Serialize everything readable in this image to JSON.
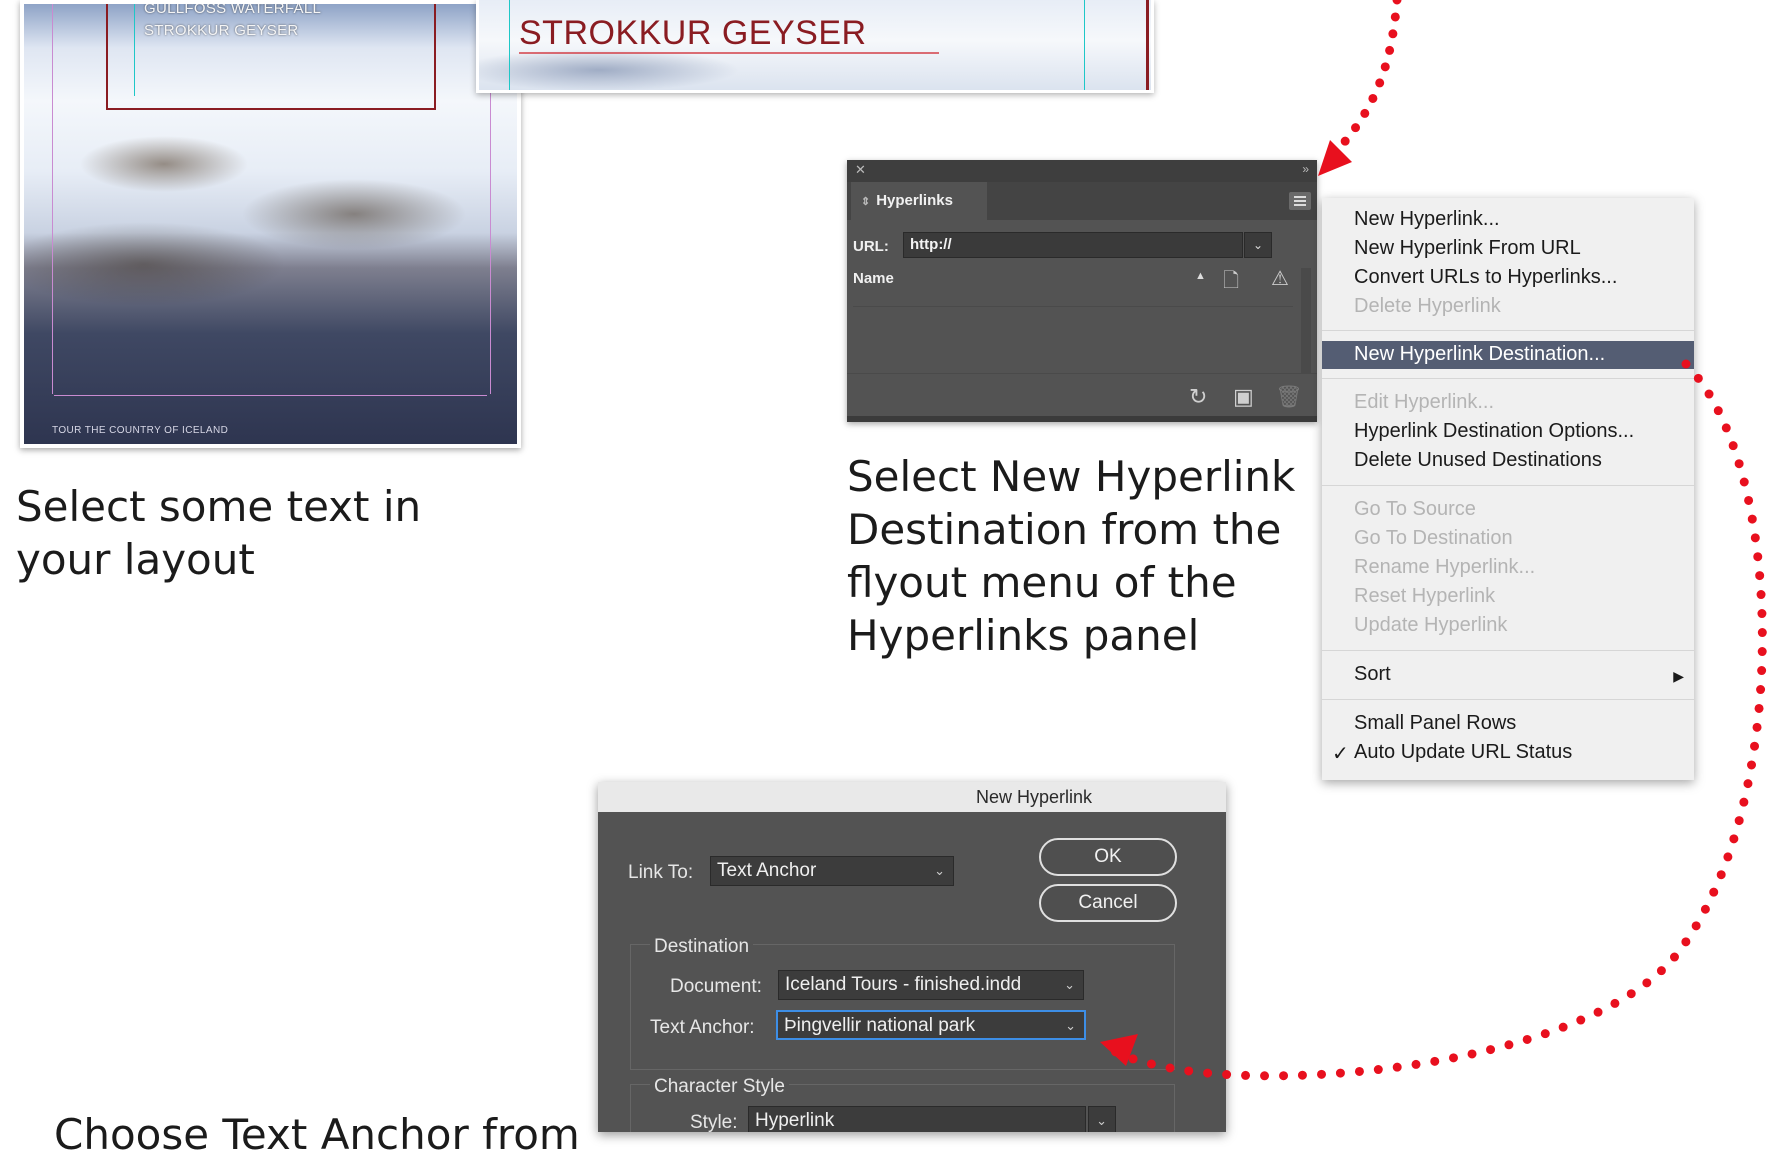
{
  "layout_photo": {
    "text_lines": [
      "GULLFOSS WATERFALL",
      "STROKKUR GEYSER"
    ],
    "footer": "TOUR THE COUNTRY OF ICELAND"
  },
  "header_photo": {
    "title": "STROKKUR GEYSER"
  },
  "captions": {
    "select_text": [
      "Select some text in",
      "your layout"
    ],
    "select_destination": [
      "Select New Hyperlink",
      "Destination from the",
      "flyout menu of the",
      "Hyperlinks panel"
    ],
    "choose_anchor": "Choose Text Anchor from"
  },
  "hyperlinks_panel": {
    "tab": "Hyperlinks",
    "url_label": "URL:",
    "url_value": "http://",
    "name_header": "Name"
  },
  "flyout_menu": {
    "group1": [
      {
        "label": "New Hyperlink...",
        "enabled": true
      },
      {
        "label": "New Hyperlink From URL",
        "enabled": true
      },
      {
        "label": "Convert URLs to Hyperlinks...",
        "enabled": true
      },
      {
        "label": "Delete Hyperlink",
        "enabled": false
      }
    ],
    "group2": [
      {
        "label": "New Hyperlink Destination...",
        "enabled": true,
        "highlighted": true
      }
    ],
    "group3": [
      {
        "label": "Edit Hyperlink...",
        "enabled": false
      },
      {
        "label": "Hyperlink Destination Options...",
        "enabled": true
      },
      {
        "label": "Delete Unused Destinations",
        "enabled": true
      }
    ],
    "group4": [
      {
        "label": "Go To Source",
        "enabled": false
      },
      {
        "label": "Go To Destination",
        "enabled": false
      },
      {
        "label": "Rename Hyperlink...",
        "enabled": false
      },
      {
        "label": "Reset Hyperlink",
        "enabled": false
      },
      {
        "label": "Update Hyperlink",
        "enabled": false
      }
    ],
    "sort": "Sort",
    "group6": [
      {
        "label": "Small Panel Rows",
        "checked": false
      },
      {
        "label": "Auto Update URL Status",
        "checked": true
      }
    ],
    "highlight_color": "#545d73"
  },
  "new_hyperlink_dialog": {
    "title": "New Hyperlink",
    "link_to_label": "Link To:",
    "link_to_value": "Text Anchor",
    "ok": "OK",
    "cancel": "Cancel",
    "destination_header": "Destination",
    "document_label": "Document:",
    "document_value": "Iceland Tours - finished.indd",
    "text_anchor_label": "Text Anchor:",
    "text_anchor_value": "Þingvellir national park",
    "character_style_header": "Character Style",
    "style_label": "Style:",
    "style_value": "Hyperlink"
  },
  "colors": {
    "annotation_red": "#e8101e",
    "panel_bg": "#535353",
    "menu_bg": "#f0f0f0"
  }
}
